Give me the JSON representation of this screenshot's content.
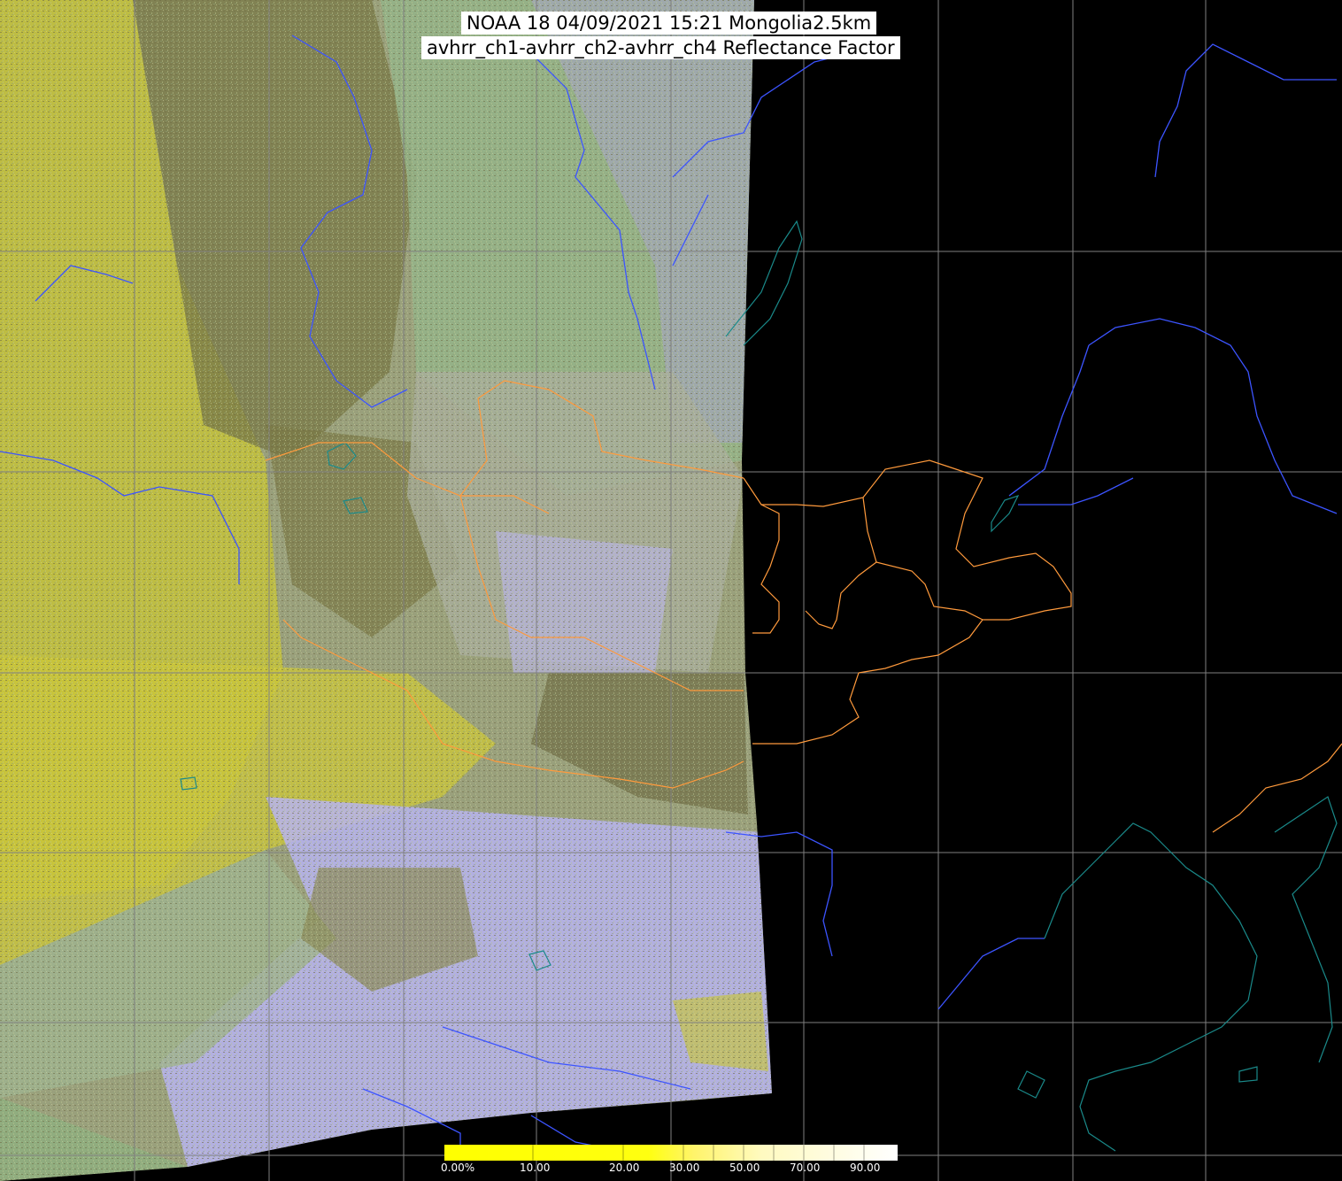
{
  "title": {
    "line1": "NOAA 18 04/09/2021 15:21 Mongolia2.5km",
    "line2": "avhrr_ch1-avhrr_ch2-avhrr_ch4 Reflectance Factor"
  },
  "colorbar": {
    "ticks": [
      "0.00%",
      "10.00",
      "20.00",
      "30.00",
      "50.00",
      "70.00",
      "90.00"
    ],
    "colors": [
      "#ffff00",
      "#fff84a",
      "#fff4a0",
      "#fffad8",
      "#ffffff"
    ]
  },
  "colors": {
    "background": "#000000",
    "graticule": "#7f7f7f",
    "rivers": "#3c54ff",
    "borders": "#ff9a3c",
    "coast": "#1a8a8a",
    "imagery_yellow": "#c9c63a",
    "imagery_olive": "#7c7a4a",
    "imagery_green": "#93b88a",
    "imagery_lavender": "#b7b4f4"
  }
}
